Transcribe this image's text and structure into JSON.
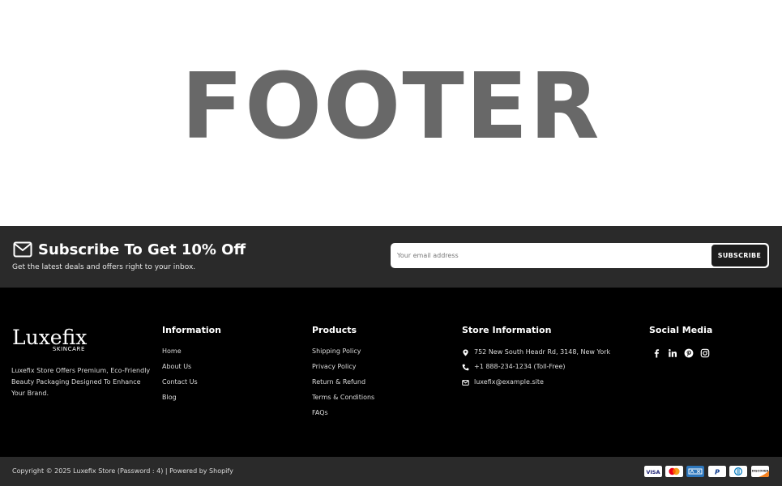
{
  "hero": {
    "title": "FOOTER"
  },
  "subscribe": {
    "icon": "mail-icon",
    "title": "Subscribe To Get 10% Off",
    "subtitle": "Get the latest deals and offers right to your inbox.",
    "email_placeholder": "Your email address",
    "button_label": "SUBSCRIBE"
  },
  "brand": {
    "logo_word": "Luxefix",
    "logo_sub": "SKINCARE",
    "description": "Luxefix Store Offers Premium, Eco-Friendly Beauty Packaging Designed To Enhance Your Brand."
  },
  "information": {
    "heading": "Information",
    "links": [
      "Home",
      "About Us",
      "Contact Us",
      "Blog"
    ]
  },
  "products": {
    "heading": "Products",
    "links": [
      "Shipping Policy",
      "Privacy Policy",
      "Return & Refund",
      "Terms & Conditions",
      "FAQs"
    ]
  },
  "store": {
    "heading": "Store Information",
    "items": [
      {
        "icon": "location-pin-icon",
        "text": "752 New South Headr Rd, 3148, New York"
      },
      {
        "icon": "phone-icon",
        "text": "+1 888-234-1234 (Toll-Free)"
      },
      {
        "icon": "mail-icon",
        "text": "luxefix@example.site"
      }
    ]
  },
  "social": {
    "heading": "Social Media",
    "icons": [
      "facebook-icon",
      "linkedin-icon",
      "pinterest-icon",
      "instagram-icon"
    ]
  },
  "bottom": {
    "copyright": "Copyright © 2025 Luxefix Store (Password : 4) | Powered by Shopify",
    "payments": [
      {
        "icon": "visa-icon",
        "label": "VISA"
      },
      {
        "icon": "mastercard-icon",
        "label": ""
      },
      {
        "icon": "amex-icon",
        "label": ""
      },
      {
        "icon": "paypal-icon",
        "label": "P"
      },
      {
        "icon": "diners-club-icon",
        "label": ""
      },
      {
        "icon": "discover-icon",
        "label": "DISCOVER"
      }
    ]
  },
  "colors": {
    "hero_text": "#686868",
    "band_bg": "#2a2a2a",
    "footer_bg": "#000000",
    "button_bg": "#1d1d1d"
  }
}
